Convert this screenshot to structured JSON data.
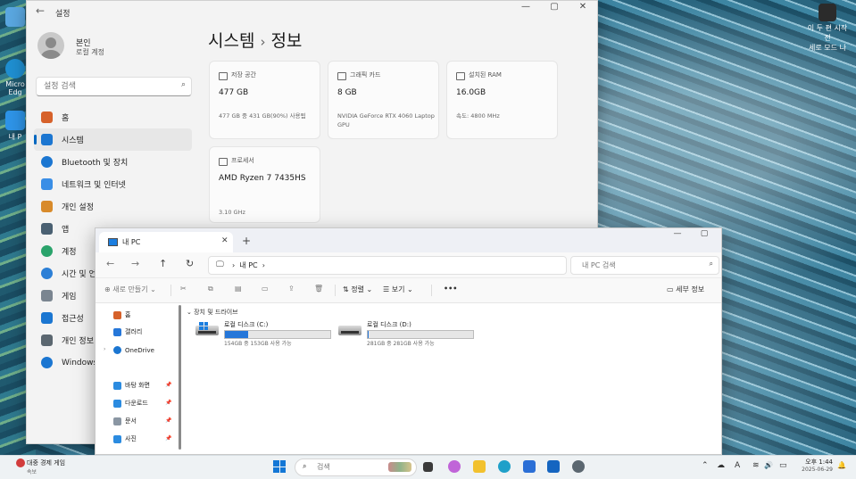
{
  "desktop": {
    "icons": [
      {
        "label": "",
        "color": "#5aa7e0"
      },
      {
        "label": "Micro Edg",
        "color": "#1f8fd1"
      },
      {
        "label": "내 P",
        "color": "#2e94e8"
      }
    ],
    "right_icon_label": "이 두 편 시작 전",
    "right_icon_label_line2": "세로 모드 나"
  },
  "settings": {
    "title": "설정",
    "controls": {
      "minimize": "—",
      "maximize": "▢",
      "close": "✕"
    },
    "profile": {
      "name": "본인",
      "subtitle": "로컬 계정"
    },
    "search": {
      "placeholder": "설정 검색"
    },
    "nav": [
      {
        "label": "홈",
        "icon": "home-icon",
        "color": "#d6612a",
        "active": false
      },
      {
        "label": "시스템",
        "icon": "system-icon",
        "color": "#1b76d1",
        "active": true
      },
      {
        "label": "Bluetooth 및 장치",
        "icon": "bluetooth-icon",
        "color": "#1b76d1",
        "active": false
      },
      {
        "label": "네트워크 및 인터넷",
        "icon": "network-icon",
        "color": "#3a8ee6",
        "active": false
      },
      {
        "label": "개인 설정",
        "icon": "brush-icon",
        "color": "#d88a2a",
        "active": false
      },
      {
        "label": "앱",
        "icon": "apps-icon",
        "color": "#4a6072",
        "active": false
      },
      {
        "label": "계정",
        "icon": "account-icon",
        "color": "#2aa36b",
        "active": false
      },
      {
        "label": "시간 및 언어",
        "icon": "time-language-icon",
        "color": "#2c7fd6",
        "active": false
      },
      {
        "label": "게임",
        "icon": "gaming-icon",
        "color": "#7a8590",
        "active": false
      },
      {
        "label": "접근성",
        "icon": "accessibility-icon",
        "color": "#1b76d1",
        "active": false
      },
      {
        "label": "개인 정보",
        "icon": "privacy-shield-icon",
        "color": "#5b6770",
        "active": false
      },
      {
        "label": "Windows",
        "icon": "windows-update-icon",
        "color": "#1b76d1",
        "active": false
      }
    ],
    "breadcrumb": {
      "parent": "시스템",
      "separator": "›",
      "current": "정보"
    },
    "cards": [
      {
        "label": "저장 공간",
        "value": "477 GB",
        "sub": "477 GB 중 431 GB(90%) 사용됨"
      },
      {
        "label": "그래픽 카드",
        "value": "8 GB",
        "sub": "NVIDIA GeForce RTX 4060 Laptop GPU"
      },
      {
        "label": "설치된 RAM",
        "value": "16.0GB",
        "sub": "속도: 4800 MHz"
      },
      {
        "label": "프로세서",
        "value": "AMD Ryzen 7 7435HS",
        "sub": "3.10 GHz"
      }
    ]
  },
  "explorer": {
    "tab_label": "내 PC",
    "tab_close": "✕",
    "new_tab": "+",
    "controls": {
      "minimize": "—",
      "maximize": "▢",
      "close": "✕"
    },
    "nav": {
      "back": "←",
      "forward": "→",
      "up": "↑",
      "refresh": "↻"
    },
    "address": {
      "monitor_glyph": "🖵",
      "sep1": "›",
      "text": "내 PC",
      "sep2": "›"
    },
    "search": {
      "placeholder": "내 PC 검색"
    },
    "toolbar": {
      "new_label": "⊕ 새로 만들기 ⌄",
      "sort_label": "⇅ 정렬 ⌄",
      "view_label": "☰ 보기 ⌄",
      "more_label": "•••",
      "details_label": "세부 정보"
    },
    "sidebar": [
      {
        "label": "홈",
        "icon": "home-icon",
        "color": "#d6612a",
        "pinned": false
      },
      {
        "label": "갤러리",
        "icon": "gallery-icon",
        "color": "#2677d9",
        "pinned": false
      },
      {
        "label": "OneDrive",
        "icon": "onedrive-icon",
        "color": "#1b76d1",
        "pinned": false
      },
      {
        "label": "바탕 화면",
        "icon": "desktop-icon",
        "color": "#2b8be0",
        "pinned": true
      },
      {
        "label": "다운로드",
        "icon": "download-icon",
        "color": "#2b8be0",
        "pinned": true
      },
      {
        "label": "문서",
        "icon": "documents-icon",
        "color": "#8a96a3",
        "pinned": true
      },
      {
        "label": "사진",
        "icon": "pictures-icon",
        "color": "#2b8be0",
        "pinned": true
      }
    ],
    "pin_glyph": "📌",
    "group_header": "장치 및 드라이브",
    "drives": [
      {
        "name": "로컬 디스크 (C:)",
        "info": "154GB 중 153GB 사용 가능",
        "used_fraction": 0.22,
        "system": true
      },
      {
        "name": "로컬 디스크 (D:)",
        "info": "281GB 중 281GB 사용 가능",
        "used_fraction": 0.01,
        "system": false
      }
    ]
  },
  "taskbar": {
    "weather_title": "대중 경제 게임",
    "weather_sub": "속보",
    "search_placeholder": "검색",
    "apps": [
      {
        "name": "task-view-icon",
        "color": "#3a3a3a"
      },
      {
        "name": "copilot-icon",
        "color": "#c064d8"
      },
      {
        "name": "file-explorer-icon",
        "color": "#f2c12e"
      },
      {
        "name": "edge-icon",
        "color": "#1fa0c9"
      },
      {
        "name": "store-icon",
        "color": "#2b6fd6"
      },
      {
        "name": "outlook-icon",
        "color": "#1565c0"
      },
      {
        "name": "settings-icon",
        "color": "#5b6770"
      }
    ],
    "tray": {
      "chevron": "⌃",
      "chat": "☁",
      "ime": "A",
      "wifi": "≋",
      "volume": "🔊",
      "battery": "▭"
    },
    "time": "오후 1:44",
    "date": "2025-06-29"
  }
}
